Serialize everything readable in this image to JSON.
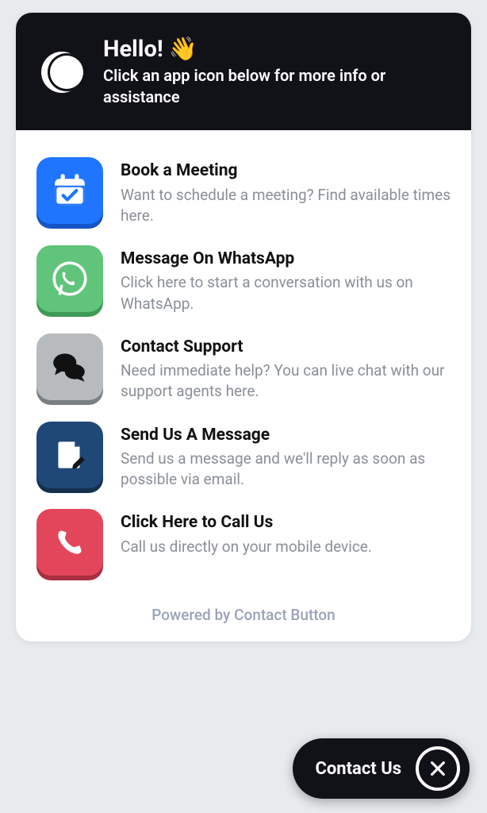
{
  "header": {
    "title": "Hello! 👋",
    "subtitle": "Click an app icon below for more info or assistance"
  },
  "options": [
    {
      "title": "Book a Meeting",
      "desc": "Want to schedule a meeting? Find available times here."
    },
    {
      "title": "Message On WhatsApp",
      "desc": "Click here to start a conversation with us on WhatsApp."
    },
    {
      "title": "Contact Support",
      "desc": "Need immediate help? You can live chat with our support agents here."
    },
    {
      "title": "Send Us A Message",
      "desc": "Send us a message and we'll reply as soon as possible via email."
    },
    {
      "title": "Click Here to Call Us",
      "desc": "Call us directly on your mobile device."
    }
  ],
  "footer": {
    "powered_by": "Powered by Contact Button"
  },
  "fab": {
    "label": "Contact Us"
  }
}
